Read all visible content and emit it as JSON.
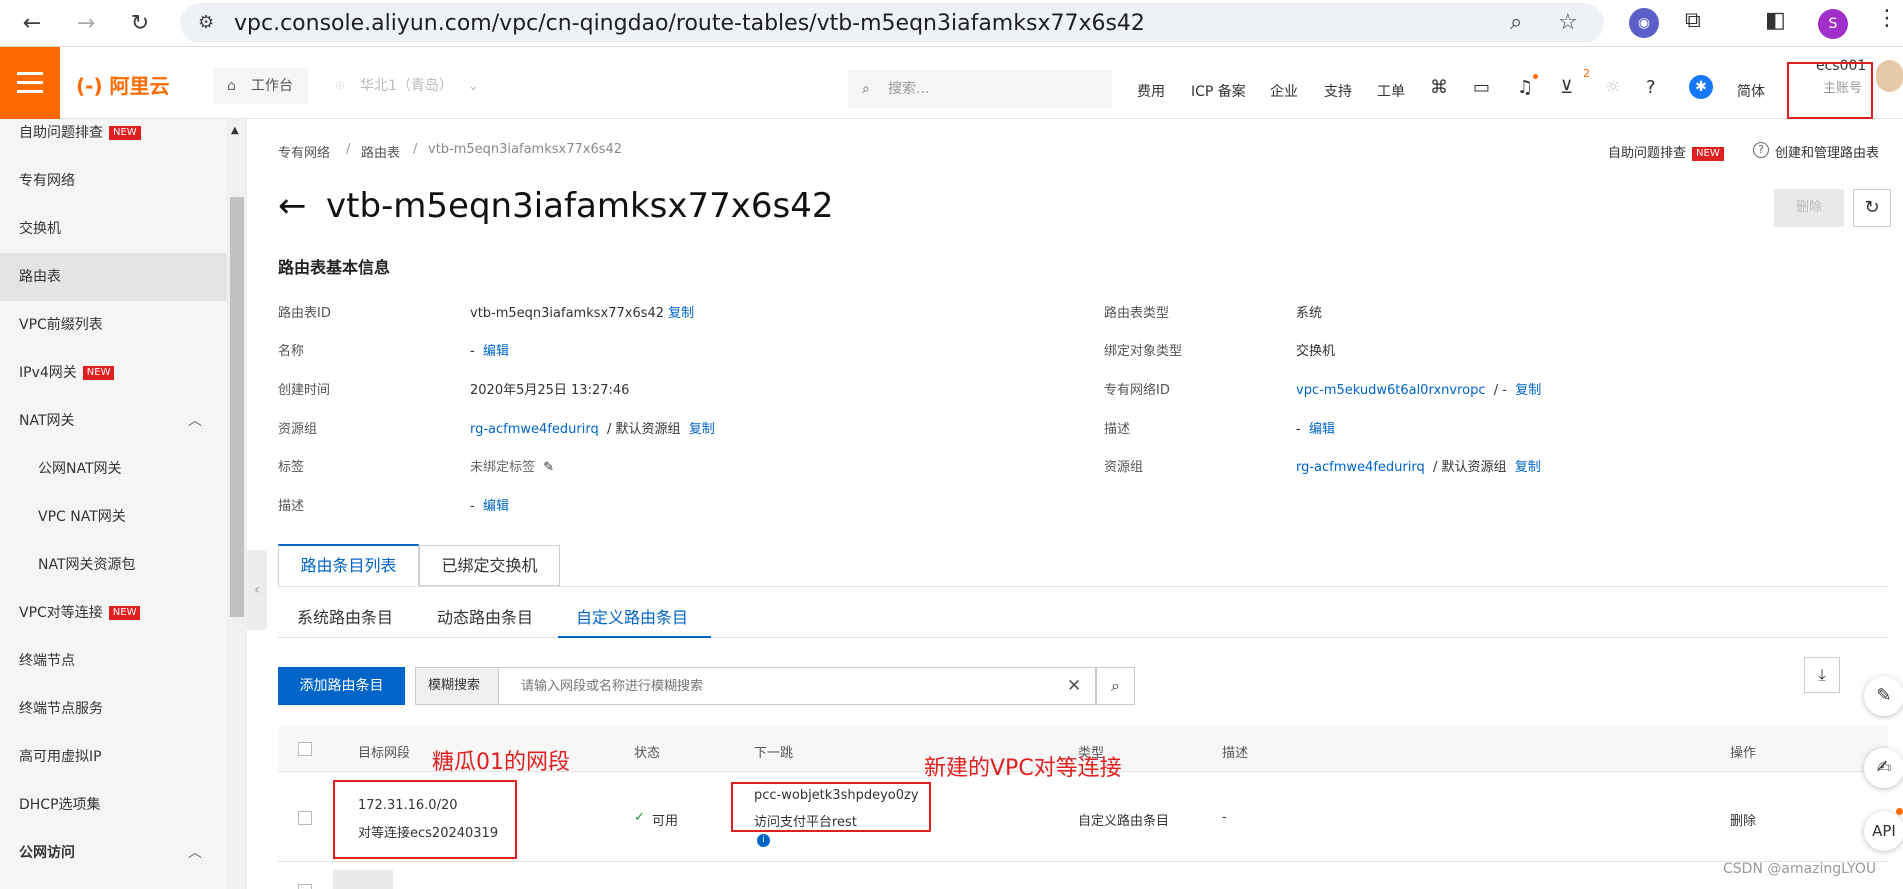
{
  "browser": {
    "url": "vpc.console.aliyun.com/vpc/cn-qingdao/route-tables/vtb-m5eqn3iafamksx77x6s42",
    "profile_initial": "S"
  },
  "topnav": {
    "logo": "(-) 阿里云",
    "workbench": "工作台",
    "region": "华北1（青岛）",
    "search_placeholder": "搜索...",
    "items": [
      "费用",
      "ICP 备案",
      "企业",
      "支持",
      "工单",
      "简体"
    ],
    "cart_count": "2",
    "account_name": "ecs001",
    "account_role": "主账号"
  },
  "sidebar": {
    "items": [
      {
        "label": "自助问题排查",
        "badge": "NEW"
      },
      {
        "label": "专有网络"
      },
      {
        "label": "交换机"
      },
      {
        "label": "路由表"
      },
      {
        "label": "VPC前缀列表"
      },
      {
        "label": "IPv4网关",
        "badge": "NEW"
      },
      {
        "label": "NAT网关"
      },
      {
        "label": "公网NAT网关"
      },
      {
        "label": "VPC NAT网关"
      },
      {
        "label": "NAT网关资源包"
      },
      {
        "label": "VPC对等连接",
        "badge": "NEW"
      },
      {
        "label": "终端节点"
      },
      {
        "label": "终端节点服务"
      },
      {
        "label": "高可用虚拟IP"
      },
      {
        "label": "DHCP选项集"
      },
      {
        "label": "公网访问"
      }
    ]
  },
  "breadcrumb": [
    "专有网络",
    "路由表",
    "vtb-m5eqn3iafamksx77x6s42"
  ],
  "header_links": {
    "troubleshoot": "自助问题排查",
    "troubleshoot_badge": "NEW",
    "help": "创建和管理路由表"
  },
  "page": {
    "title": "vtb-m5eqn3iafamksx77x6s42",
    "delete": "删除",
    "section_title": "路由表基本信息"
  },
  "info_left": [
    {
      "label": "路由表ID",
      "value": "vtb-m5eqn3iafamksx77x6s42",
      "action": "复制"
    },
    {
      "label": "名称",
      "value": "-",
      "action": "编辑"
    },
    {
      "label": "创建时间",
      "value": "2020年5月25日 13:27:46"
    },
    {
      "label": "资源组",
      "link": "rg-acfmwe4fedurirq",
      "value": "/  默认资源组",
      "action": "复制"
    },
    {
      "label": "标签",
      "value": "未绑定标签"
    },
    {
      "label": "描述",
      "value": "-",
      "action": "编辑"
    }
  ],
  "info_right": [
    {
      "label": "路由表类型",
      "value": "系统"
    },
    {
      "label": "绑定对象类型",
      "value": "交换机"
    },
    {
      "label": "专有网络ID",
      "link": "vpc-m5ekudw6t6al0rxnvropc",
      "value": "/  -",
      "action": "复制"
    },
    {
      "label": "描述",
      "value": "-",
      "action": "编辑"
    },
    {
      "label": "资源组",
      "link": "rg-acfmwe4fedurirq",
      "value": "/  默认资源组",
      "action": "复制"
    }
  ],
  "tabs": [
    "路由条目列表",
    "已绑定交换机"
  ],
  "subtabs": [
    "系统路由条目",
    "动态路由条目",
    "自定义路由条目"
  ],
  "toolbar": {
    "add_route": "添加路由条目",
    "filter_mode": "模糊搜索",
    "filter_placeholder": "请输入网段或名称进行模糊搜索"
  },
  "table": {
    "headers": [
      "目标网段",
      "状态",
      "下一跳",
      "类型",
      "描述",
      "操作"
    ],
    "row": {
      "cidr": "172.31.16.0/20",
      "cidr_name": "对等连接ecs20240319",
      "status": "可用",
      "next_hop_id": "pcc-wobjetk3shpdeyo0zy",
      "next_hop_name": "访问支付平台rest",
      "type": "自定义路由条目",
      "description": "-",
      "action": "删除"
    }
  },
  "annotations": {
    "cidr_note": "糖瓜01的网段",
    "peer_note": "新建的VPC对等连接"
  },
  "watermark": "CSDN @amazingLYOU",
  "float_tools": {
    "api": "API"
  }
}
